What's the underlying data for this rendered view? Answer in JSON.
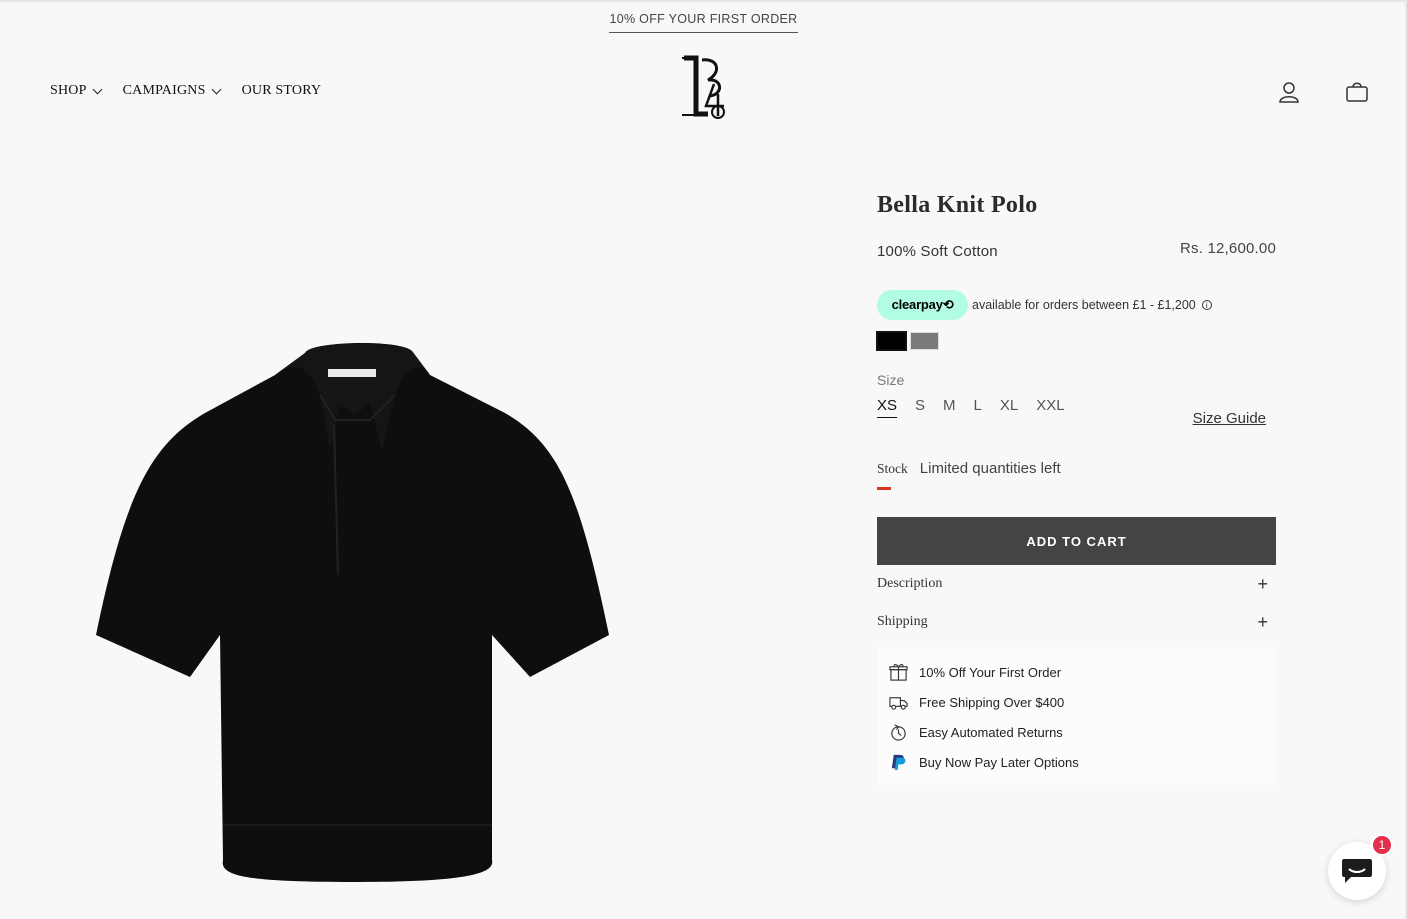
{
  "announcement": "10% OFF YOUR FIRST ORDER",
  "nav": {
    "shop": "SHOP",
    "campaigns": "CAMPAIGNS",
    "our_story": "OUR STORY"
  },
  "header_icons": [
    "account-icon",
    "cart-icon"
  ],
  "product": {
    "title": "Bella Knit Polo",
    "subtitle": "100% Soft Cotton",
    "price": "Rs. 12,600.00",
    "clearpay": {
      "badge": "clearpay⟲",
      "text": "available for orders between £1 - £1,200",
      "info": "i"
    },
    "colors": [
      "#000000",
      "#7b7a79"
    ],
    "size_label": "Size",
    "sizes": [
      "XS",
      "S",
      "M",
      "L",
      "XL",
      "XXL"
    ],
    "selected_size": "XS",
    "size_guide": "Size Guide",
    "stock_label": "Stock",
    "stock_text": "Limited quantities left",
    "add_to_cart": "ADD TO CART",
    "accordions": [
      "Description",
      "Shipping"
    ],
    "perks": [
      {
        "icon": "gift-icon",
        "text": "10% Off Your First Order"
      },
      {
        "icon": "truck-icon",
        "text": "Free Shipping Over $400"
      },
      {
        "icon": "returns-icon",
        "text": "Easy Automated Returns"
      },
      {
        "icon": "paypal-icon",
        "text": "Buy Now Pay Later Options"
      }
    ]
  },
  "chat": {
    "badge_count": "1"
  }
}
